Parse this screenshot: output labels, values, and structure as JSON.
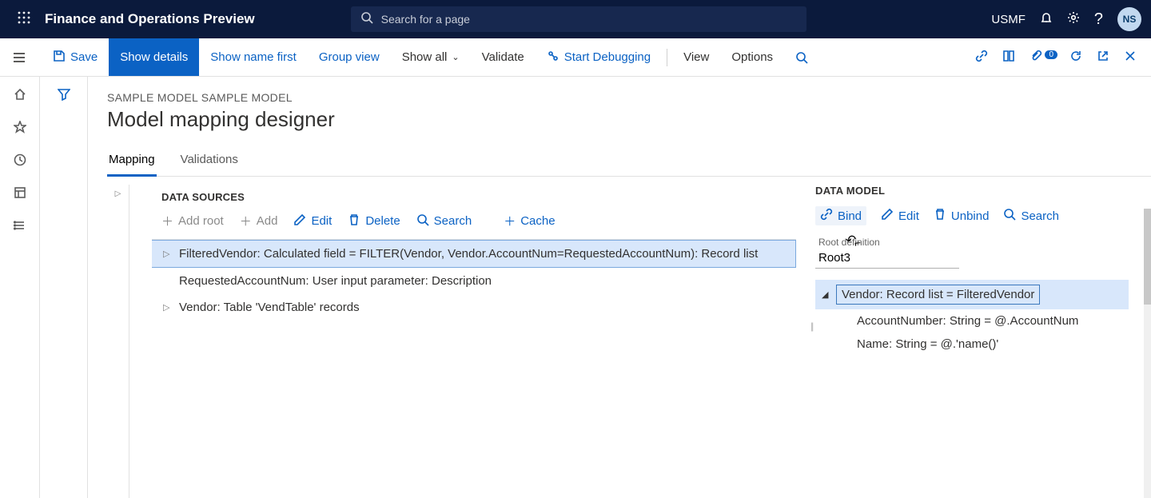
{
  "top": {
    "app_title": "Finance and Operations Preview",
    "search_placeholder": "Search for a page",
    "company": "USMF",
    "avatar": "NS"
  },
  "cmd": {
    "save": "Save",
    "show_details": "Show details",
    "show_name_first": "Show name first",
    "group_view": "Group view",
    "show_all": "Show all",
    "validate": "Validate",
    "start_debugging": "Start Debugging",
    "view": "View",
    "options": "Options",
    "badge": "0"
  },
  "page": {
    "breadcrumb": "SAMPLE MODEL SAMPLE MODEL",
    "title": "Model mapping designer"
  },
  "tabs": {
    "mapping": "Mapping",
    "validations": "Validations"
  },
  "ds": {
    "title": "DATA SOURCES",
    "add_root": "Add root",
    "add": "Add",
    "edit": "Edit",
    "delete": "Delete",
    "search": "Search",
    "cache": "Cache",
    "items": [
      "FilteredVendor: Calculated field = FILTER(Vendor, Vendor.AccountNum=RequestedAccountNum): Record list",
      "RequestedAccountNum: User input parameter: Description",
      "Vendor: Table 'VendTable' records"
    ]
  },
  "dm": {
    "title": "DATA MODEL",
    "bind": "Bind",
    "edit": "Edit",
    "unbind": "Unbind",
    "search": "Search",
    "root_label": "Root definition",
    "root_value": "Root3",
    "items": [
      "Vendor: Record list = FilteredVendor",
      "AccountNumber: String = @.AccountNum",
      "Name: String = @.'name()'"
    ]
  }
}
